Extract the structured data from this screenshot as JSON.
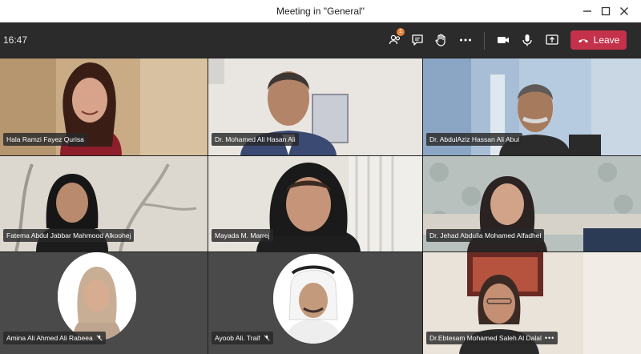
{
  "window": {
    "title": "Meeting in \"General\""
  },
  "toolbar": {
    "time": "16:47",
    "participants_badge": "1",
    "leave_label": "Leave"
  },
  "participants": [
    {
      "name": "Hala Ramzi Fayez Qurisa"
    },
    {
      "name": "Dr. Mohamed Ali Hasan Ali"
    },
    {
      "name": "Dr. AbdulAziz Hassan Ali Abul"
    },
    {
      "name": "Fatema Abdul Jabbar Mahmood Alkoohej"
    },
    {
      "name": "Mayada M. Marrej"
    },
    {
      "name": "Dr. Jehad Abdulla Mohamed Alfadhel"
    },
    {
      "name": "Amina Ali Ahmed Ali Rabeea"
    },
    {
      "name": "Ayoob Ali. Traif"
    },
    {
      "name": "Dr.Ebtesam Mohamed Saleh Al Dalal",
      "more": "•••"
    }
  ]
}
